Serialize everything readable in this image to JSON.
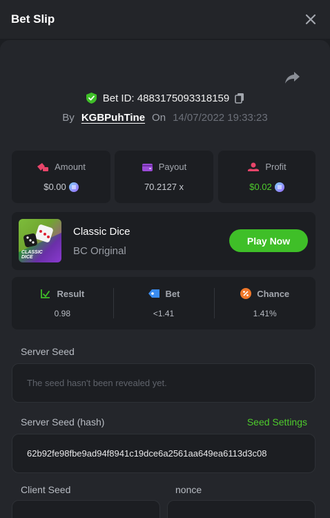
{
  "header": {
    "title": "Bet Slip"
  },
  "bet": {
    "id_label": "Bet ID: 4883175093318159",
    "by_label": "By",
    "username": "KGBPuhTine",
    "on_label": "On",
    "timestamp": "14/07/2022 19:33:23"
  },
  "stats": {
    "amount": {
      "label": "Amount",
      "value": "$0.00"
    },
    "payout": {
      "label": "Payout",
      "value": "70.2127 x"
    },
    "profit": {
      "label": "Profit",
      "value": "$0.02"
    }
  },
  "game": {
    "thumb_text_line1": "CLASSIC",
    "thumb_text_line2": "DICE",
    "title": "Classic Dice",
    "subtitle": "BC Original",
    "play_label": "Play Now"
  },
  "results": {
    "result": {
      "label": "Result",
      "value": "0.98"
    },
    "bet": {
      "label": "Bet",
      "value": "<1.41"
    },
    "chance": {
      "label": "Chance",
      "value": "1.41%"
    }
  },
  "seeds": {
    "server_seed_label": "Server Seed",
    "server_seed_placeholder": "The seed hasn't been revealed yet.",
    "server_hash_label": "Server Seed (hash)",
    "seed_settings_link": "Seed Settings",
    "server_hash_value": "62b92fe98fbe9ad94f8941c19dce6a2561aa649ea6113d3c08",
    "client_seed_label": "Client Seed",
    "nonce_label": "nonce"
  },
  "colors": {
    "accent_green": "#3fbf28",
    "profit_green": "#4ecb2c",
    "background": "#1c1e22",
    "panel": "#24262b"
  }
}
